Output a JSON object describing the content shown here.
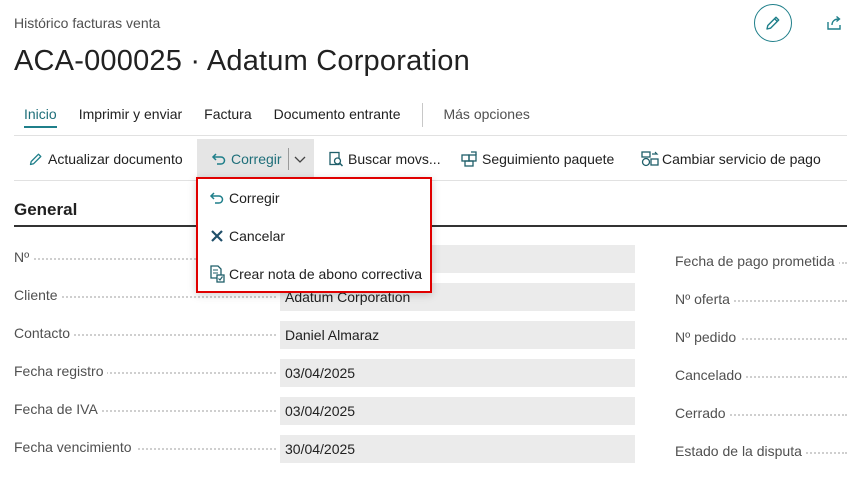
{
  "header": {
    "breadcrumb": "Histórico facturas venta",
    "title": "ACA-000025 · Adatum Corporation"
  },
  "tabs": [
    {
      "label": "Inicio"
    },
    {
      "label": "Imprimir y enviar"
    },
    {
      "label": "Factura"
    },
    {
      "label": "Documento entrante"
    },
    {
      "label": "Más opciones"
    }
  ],
  "actions": {
    "update_document": "Actualizar documento",
    "correct": "Corregir",
    "find_entries": "Buscar movs...",
    "track_package": "Seguimiento paquete",
    "change_payment_service": "Cambiar servicio de pago"
  },
  "dropdown": {
    "items": [
      {
        "label": "Corregir",
        "icon": "undo-icon"
      },
      {
        "label": "Cancelar",
        "icon": "close-icon"
      },
      {
        "label": "Crear nota de abono correctiva",
        "icon": "credit-memo-icon"
      }
    ]
  },
  "section": {
    "title": "General"
  },
  "fields": [
    {
      "label": "Nº",
      "value": ""
    },
    {
      "label": "Cliente",
      "value": "Adatum Corporation"
    },
    {
      "label": "Contacto",
      "value": "Daniel Almaraz"
    },
    {
      "label": "Fecha registro",
      "value": "03/04/2025"
    },
    {
      "label": "Fecha de IVA",
      "value": "03/04/2025"
    },
    {
      "label": "Fecha vencimiento",
      "value": "30/04/2025"
    }
  ],
  "right_fields": [
    {
      "label": "Fecha de pago prometida"
    },
    {
      "label": "Nº oferta"
    },
    {
      "label": "Nº pedido"
    },
    {
      "label": "Cancelado"
    },
    {
      "label": "Cerrado"
    },
    {
      "label": "Estado de la disputa"
    }
  ],
  "colors": {
    "accent": "#1f7f8a",
    "highlight_border": "#e00000"
  }
}
